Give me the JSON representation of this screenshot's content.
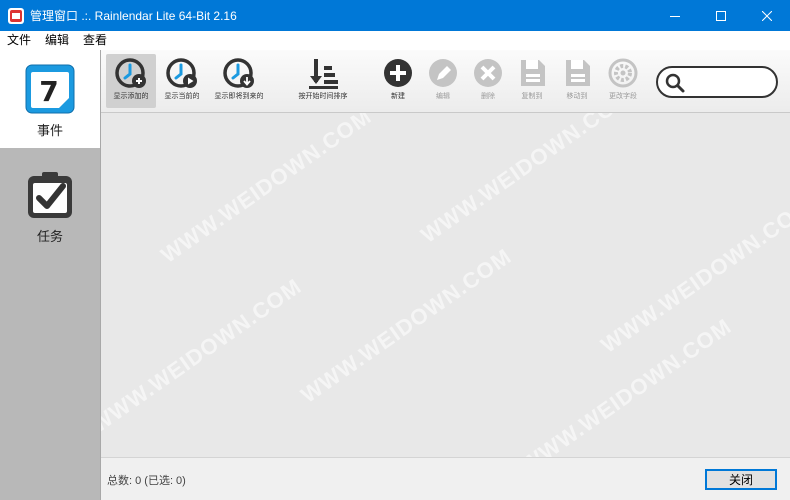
{
  "window": {
    "title": "管理窗口 .:. Rainlendar Lite 64-Bit 2.16"
  },
  "menu": [
    "文件",
    "编辑",
    "查看"
  ],
  "sidebar": {
    "items": [
      {
        "label": "事件",
        "icon": "calendar-icon",
        "day": "7",
        "active": true
      },
      {
        "label": "任务",
        "icon": "task-clipboard-icon",
        "active": false
      }
    ]
  },
  "toolbar": {
    "buttons": [
      {
        "label": "显示添加的",
        "icon": "show-added-icon",
        "selected": true,
        "disabled": false
      },
      {
        "label": "显示当前的",
        "icon": "show-current-icon",
        "selected": false,
        "disabled": false
      },
      {
        "label": "显示即将到来的",
        "icon": "show-upcoming-icon",
        "selected": false,
        "disabled": false
      },
      {
        "label": "按开始时间排序",
        "icon": "sort-by-start-time-icon",
        "selected": false,
        "disabled": false
      },
      {
        "label": "新建",
        "icon": "new-icon",
        "selected": false,
        "disabled": false
      },
      {
        "label": "编辑",
        "icon": "edit-icon",
        "selected": false,
        "disabled": true
      },
      {
        "label": "删除",
        "icon": "delete-icon",
        "selected": false,
        "disabled": true
      },
      {
        "label": "复制到",
        "icon": "copy-to-icon",
        "selected": false,
        "disabled": true
      },
      {
        "label": "移动到",
        "icon": "move-to-icon",
        "selected": false,
        "disabled": true
      },
      {
        "label": "更改字段",
        "icon": "change-fields-icon",
        "selected": false,
        "disabled": true
      }
    ],
    "search": {
      "value": "",
      "placeholder": ""
    }
  },
  "footer": {
    "status": "总数: 0 (已选: 0)",
    "close_label": "关闭"
  },
  "watermark": "WWW.WEIDOWN.COM",
  "colors": {
    "titlebar": "#0078d7",
    "calendar_blue": "#1b9ae0",
    "sidebar_bg": "#b8b8b8",
    "content_bg": "#e8e8e8"
  }
}
